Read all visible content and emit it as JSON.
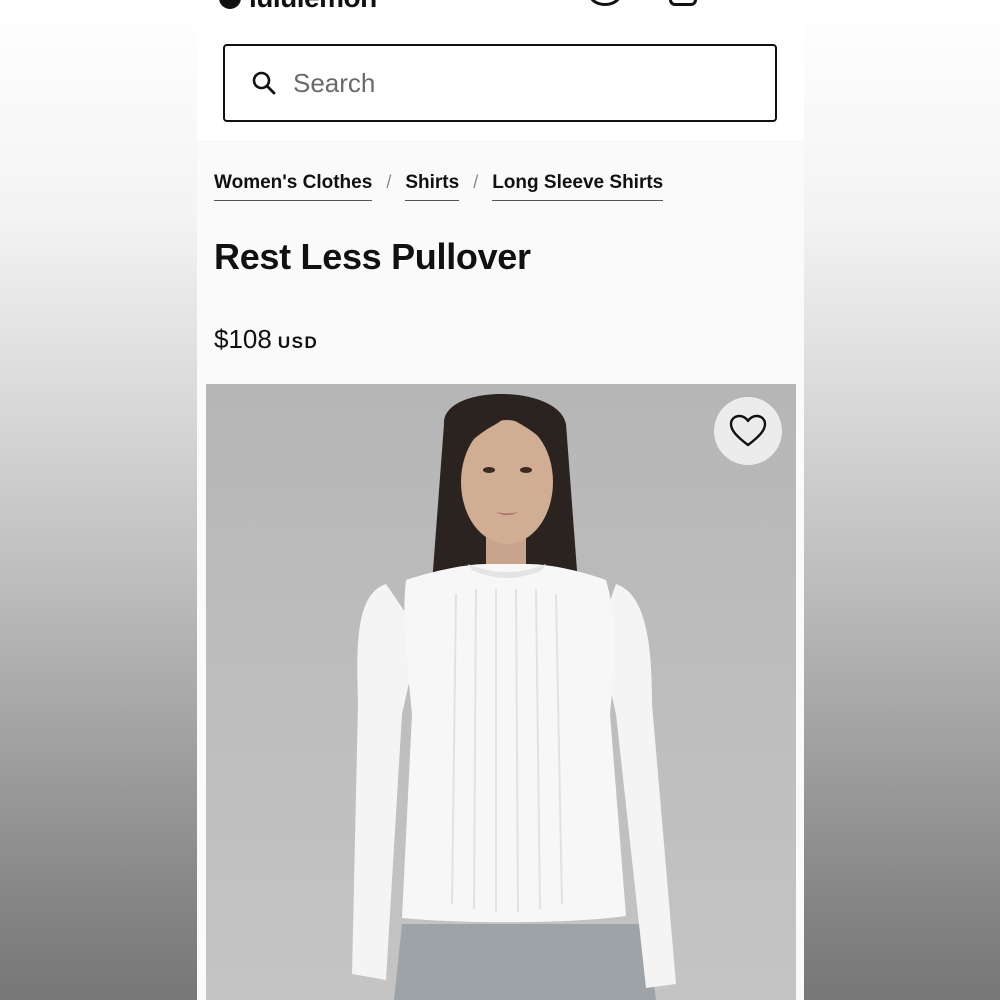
{
  "header": {
    "logo_text": "lululemon",
    "icons": [
      "account-icon",
      "bag-icon"
    ]
  },
  "search": {
    "placeholder": "Search",
    "value": ""
  },
  "breadcrumb": {
    "items": [
      {
        "label": "Women's Clothes"
      },
      {
        "label": "Shirts"
      },
      {
        "label": "Long Sleeve Shirts"
      }
    ],
    "separator": "/"
  },
  "product": {
    "title": "Rest Less Pullover",
    "price": "$108",
    "currency": "USD",
    "image_subject": "product-photo",
    "wishlist_icon": "heart-icon"
  },
  "colors": {
    "text": "#111111",
    "background": "#fafafa",
    "image_background": "#bcbcbc",
    "wishlist_background": "#ececec"
  }
}
